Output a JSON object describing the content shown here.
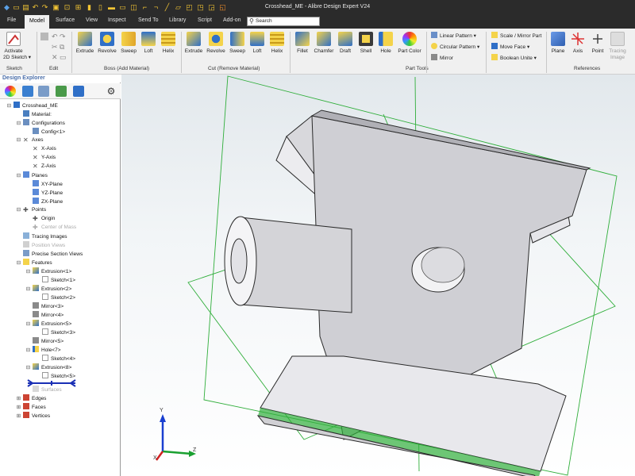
{
  "window": {
    "title": "Crosshead_ME - Alibre Design Expert V24"
  },
  "menu": [
    "File",
    "Model",
    "Surface",
    "View",
    "Inspect",
    "Send To",
    "Library",
    "Script",
    "Add-on"
  ],
  "search": {
    "placeholder": "Search"
  },
  "ribbon": {
    "sketch": {
      "btn1": "Activate",
      "btn2": "2D Sketch ▾",
      "group": "Sketch"
    },
    "edit": {
      "group": "Edit"
    },
    "boss": {
      "items": [
        "Extrude",
        "Revolve",
        "Sweep",
        "Loft",
        "Helix"
      ],
      "group": "Boss (Add Material)"
    },
    "cut": {
      "items": [
        "Extrude",
        "Revolve",
        "Sweep",
        "Loft",
        "Helix"
      ],
      "group": "Cut (Remove Material)"
    },
    "part_tools": {
      "items": [
        "Fillet",
        "Chamfer",
        "Draft",
        "Shell",
        "Hole",
        "Part Color"
      ],
      "group": "Part Tools"
    },
    "pattern": {
      "items": [
        "Linear Pattern ▾",
        "Circular Pattern ▾",
        "Mirror"
      ]
    },
    "part_ops": {
      "items": [
        "Scale / Mirror Part",
        "Move Face ▾",
        "Boolean Unite ▾"
      ]
    },
    "references": {
      "items": [
        "Plane",
        "Axis",
        "Point",
        "Tracing Image"
      ],
      "group": "References"
    }
  },
  "explorer": {
    "title": "Design Explorer",
    "tree": [
      "Crosshead_ME",
      "Material:",
      "Configurations",
      "Config<1>",
      "Axes",
      "X-Axis",
      "Y-Axis",
      "Z-Axis",
      "Planes",
      "XY-Plane",
      "YZ-Plane",
      "ZX-Plane",
      "Points",
      "Origin",
      "Center of Mass",
      "Tracing Images",
      "Position Views",
      "Precise Section Views",
      "Features",
      "Extrusion<1>",
      "Sketch<1>",
      "Extrusion<2>",
      "Sketch<2>",
      "Mirror<3>",
      "Mirror<4>",
      "Extrusion<5>",
      "Sketch<3>",
      "Mirror<5>",
      "Hole<7>",
      "Sketch<4>",
      "Extrusion<8>",
      "Sketch<5>",
      "Surfaces",
      "Edges",
      "Faces",
      "Vertices"
    ]
  },
  "triad": {
    "x": "X",
    "y": "Y",
    "z": "Z"
  },
  "colors": {
    "accent": "#4a6ea9",
    "plane": "#2fae3a",
    "part": "#cfcfd4"
  }
}
